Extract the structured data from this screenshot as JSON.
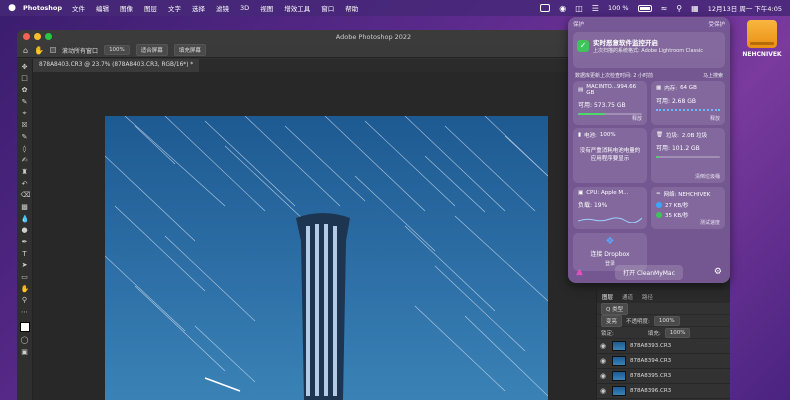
{
  "menubar": {
    "app_name": "Photoshop",
    "menus": [
      "文件",
      "编辑",
      "图像",
      "图层",
      "文字",
      "选择",
      "滤镜",
      "3D",
      "视图",
      "增效工具",
      "窗口",
      "帮助"
    ],
    "battery": "100 %",
    "clock": "12月13日 周一 下午4:05"
  },
  "photoshop": {
    "window_title": "Adobe Photoshop 2022",
    "options": {
      "scroll_all": "滚动所有窗口",
      "zoom_value": "100%",
      "fit_screen": "适合屏幕",
      "fill_screen": "填充屏幕"
    },
    "doc_tab": "878A8403.CR3 @ 23.7% (878A8403.CR3, RGB/16*) *",
    "layers_panel": {
      "tabs": [
        "图层",
        "通道",
        "路径"
      ],
      "filter": "Q 类型",
      "blend_mode": "变亮",
      "opacity_label": "不透明度:",
      "opacity": "100%",
      "lock_label": "锁定:",
      "fill_label": "填充:",
      "fill": "100%",
      "layers": [
        "878A8393.CR3",
        "878A8394.CR3",
        "878A8395.CR3",
        "878A8396.CR3"
      ]
    }
  },
  "cleanmymac": {
    "header_left": "保护",
    "header_right": "受保护",
    "protection_title": "实时恶意软件监控开启",
    "protection_sub": "上次扫描的系统格式: Adobe Lightroom Classic",
    "db_update": "数据库更新上次检查时间: 2 小时前",
    "update_now": "马上搜索",
    "disk_label": "MACINTO...994.66 GB",
    "disk_avail_label": "可用:",
    "disk_avail": "573.75 GB",
    "disk_action": "释放",
    "memory_label": "内存:",
    "memory_total": "64 GB",
    "memory_avail_label": "可用:",
    "memory_avail": "2.68 GB",
    "memory_action": "释放",
    "battery_label": "电池:",
    "battery_value": "100%",
    "battery_text": "没有严重消耗电池电量的应用程序要显示",
    "trash_label": "垃圾:",
    "trash_size": "2.0B 垃圾",
    "trash_avail_label": "可用:",
    "trash_avail": "101.2 GB",
    "trash_action": "清倒垃圾桶",
    "cpu_label": "CPU: Apple M...",
    "cpu_load_label": "负载:",
    "cpu_load": "19%",
    "net_label": "网络: NEHCHIVEK",
    "net_up": "27 KB/秒",
    "net_down": "35 KB/秒",
    "net_action": "测试速度",
    "dropbox_title": "连接 Dropbox",
    "dropbox_sub": "登录",
    "open_button": "打开 CleanMyMac",
    "colors": {
      "accent_green": "#4fd96a",
      "panel": "#7a5a96"
    }
  },
  "desktop": {
    "drive_label": "NEHCNIVEK"
  }
}
